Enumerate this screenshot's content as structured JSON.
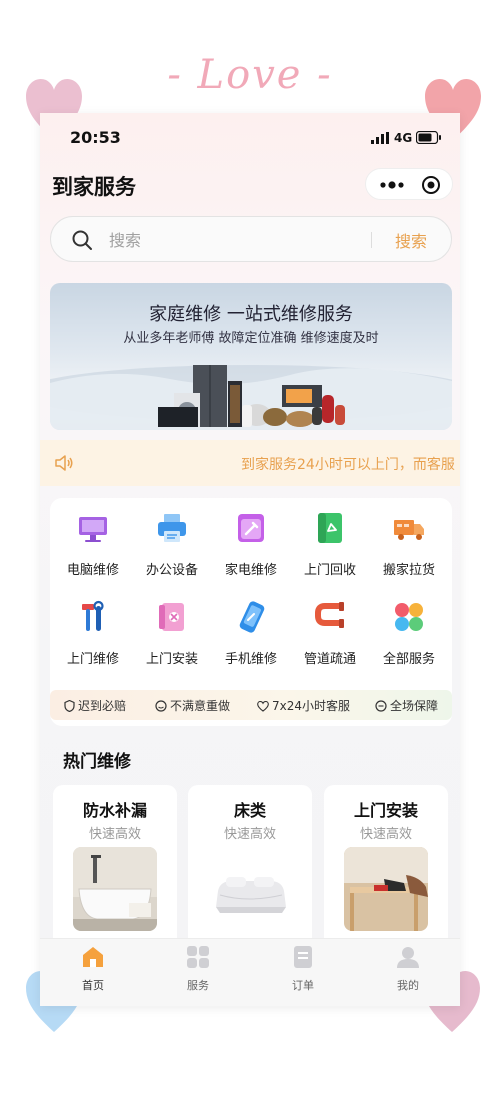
{
  "decor": {
    "love": "- Love -"
  },
  "status": {
    "time": "20:53",
    "network": "4G"
  },
  "header": {
    "title": "到家服务"
  },
  "search": {
    "placeholder": "搜索",
    "button": "搜索"
  },
  "banner": {
    "title": "家庭维修 一站式维修服务",
    "subtitle": "从业多年老师傅 故障定位准确 维修速度及时"
  },
  "notice": {
    "text": "到家服务24小时可以上门，而客服"
  },
  "services": [
    {
      "label": "电脑维修",
      "icon": "computer-icon"
    },
    {
      "label": "办公设备",
      "icon": "printer-icon"
    },
    {
      "label": "家电维修",
      "icon": "appliance-icon"
    },
    {
      "label": "上门回收",
      "icon": "recycle-icon"
    },
    {
      "label": "搬家拉货",
      "icon": "truck-icon"
    },
    {
      "label": "上门维修",
      "icon": "tools-icon"
    },
    {
      "label": "上门安装",
      "icon": "install-icon"
    },
    {
      "label": "手机维修",
      "icon": "phone-icon"
    },
    {
      "label": "管道疏通",
      "icon": "pipe-icon"
    },
    {
      "label": "全部服务",
      "icon": "all-services-icon"
    }
  ],
  "guarantees": [
    "迟到必赔",
    "不满意重做",
    "7x24小时客服",
    "全场保障"
  ],
  "hot": {
    "title": "热门维修",
    "items": [
      {
        "title": "防水补漏",
        "subtitle": "快速高效"
      },
      {
        "title": "床类",
        "subtitle": "快速高效"
      },
      {
        "title": "上门安装",
        "subtitle": "快速高效"
      }
    ]
  },
  "tabs": [
    {
      "label": "首页",
      "icon": "home-icon",
      "active": true
    },
    {
      "label": "服务",
      "icon": "grid-icon",
      "active": false
    },
    {
      "label": "订单",
      "icon": "order-icon",
      "active": false
    },
    {
      "label": "我的",
      "icon": "profile-icon",
      "active": false
    }
  ],
  "colors": {
    "accent": "#e8a14f",
    "notice_bg": "#fdf3e4"
  }
}
